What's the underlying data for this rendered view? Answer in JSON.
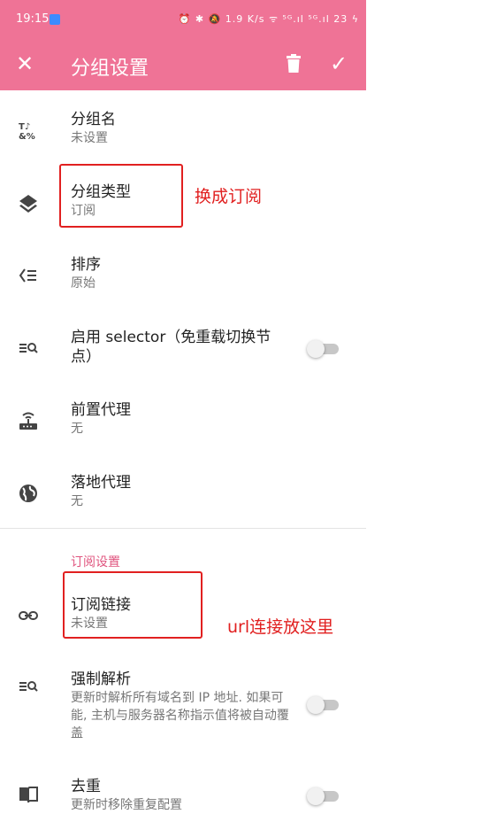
{
  "status_bar": {
    "time": "19:15",
    "icons": "⏰ ✱ 🔕 1.9 K/s ᯤ ⁵ᴳ.ıl ⁵ᴳ.ıl 23 ϟ"
  },
  "toolbar": {
    "title": "分组设置"
  },
  "items": {
    "group_name": {
      "title": "分组名",
      "value": "未设置"
    },
    "group_type": {
      "title": "分组类型",
      "value": "订阅"
    },
    "sort": {
      "title": "排序",
      "value": "原始"
    },
    "selector": {
      "title": "启用 selector（免重载切换节点）",
      "enabled": false
    },
    "front_proxy": {
      "title": "前置代理",
      "value": "无"
    },
    "landing_proxy": {
      "title": "落地代理",
      "value": "无"
    }
  },
  "subscription_section": {
    "header": "订阅设置",
    "link": {
      "title": "订阅链接",
      "value": "未设置"
    },
    "force_resolve": {
      "title": "强制解析",
      "description": "更新时解析所有域名到 IP 地址. 如果可能, 主机与服务器名称指示值将被自动覆盖",
      "enabled": false
    },
    "dedupe": {
      "title": "去重",
      "description": "更新时移除重复配置",
      "enabled": false
    }
  },
  "annotations": {
    "type_note": "换成订阅",
    "url_note": "url连接放这里"
  },
  "colors": {
    "accent": "#ef7396",
    "section": "#e0557f",
    "annotation": "#e12020"
  }
}
